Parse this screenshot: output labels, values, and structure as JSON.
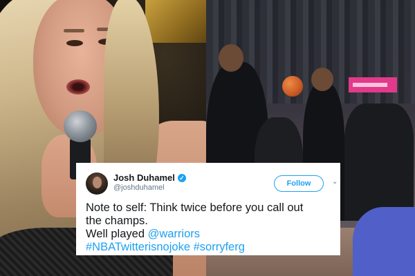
{
  "tweet": {
    "display_name": "Josh Duhamel",
    "verified_glyph": "✓",
    "handle": "@joshduhamel",
    "follow_label": "Follow",
    "chevron_glyph": "⌄",
    "lines": {
      "line1": "Note to self: Think twice before you call out",
      "line2": "the champs.",
      "line3_text": "Well played ",
      "line3_mention": "@warriors",
      "line4_hashtag1": "#NBATwitterisnojoke",
      "line4_hashtag2": "#sorryferg"
    }
  },
  "colors": {
    "link": "#1da1f2",
    "text": "#14171a",
    "secondary": "#657786"
  },
  "icons": {
    "verified": "verified-badge-icon",
    "caret": "chevron-down-icon",
    "avatar": "avatar"
  }
}
